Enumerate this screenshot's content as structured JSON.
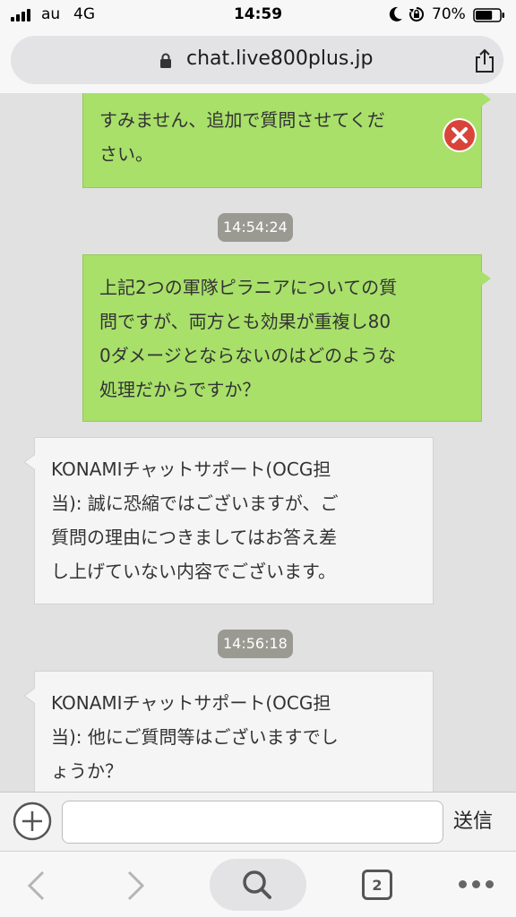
{
  "status_bar": {
    "carrier": "au",
    "network": "4G",
    "time": "14:59",
    "battery_percent": "70%",
    "battery_level": 0.7
  },
  "browser": {
    "url": "chat.live800plus.jp"
  },
  "chat": {
    "messages": [
      {
        "sender": "me",
        "text": "すみません、追加で質問させてくだ\nさい。"
      },
      {
        "sender": "me",
        "text": "上記2つの軍隊ピラニアについての質\n問ですが、両方とも効果が重複し80\n0ダメージとならないのはどのような\n処理だからですか？"
      },
      {
        "sender": "support",
        "text": "KONAMIチャットサポート(OCG担\n当): 誠に恐縮ではございますが、ご\n質問の理由につきましてはお答え差\nし上げていない内容でございます。"
      },
      {
        "sender": "support",
        "text": "KONAMIチャットサポート(OCG担\n当): 他にご質問等はございますでし\nょうか？"
      }
    ],
    "timestamps": [
      "14:54:24",
      "14:56:18"
    ]
  },
  "input_bar": {
    "placeholder": "",
    "send_label": "送信"
  },
  "toolbar": {
    "tab_count": "2"
  },
  "colors": {
    "my_bubble": "#a8e06a",
    "support_bubble": "#f5f5f5",
    "chat_background": "#e1e1e1",
    "timestamp_badge": "#9a9a93",
    "delete_icon": "#d9443a"
  },
  "icons": [
    "moon-icon",
    "lock-rotation-icon",
    "battery-icon",
    "lock-icon",
    "share-icon",
    "delete-icon",
    "plus-icon",
    "back-icon",
    "forward-icon",
    "search-icon",
    "tabs-icon",
    "more-icon"
  ]
}
